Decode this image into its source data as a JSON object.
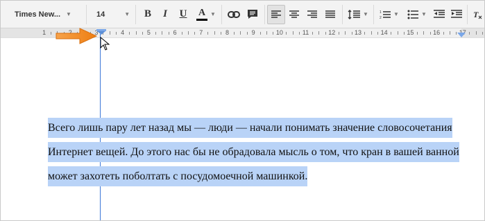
{
  "toolbar": {
    "font_family": "Times New...",
    "font_size": "14",
    "bold_label": "B",
    "italic_label": "I",
    "underline_label": "U",
    "text_color_label": "A"
  },
  "icons": {
    "link": "link-icon",
    "comment": "comment-icon",
    "align_left": "align-left-icon",
    "align_center": "align-center-icon",
    "align_right": "align-right-icon",
    "align_justify": "align-justify-icon",
    "line_spacing": "line-spacing-icon",
    "numbered_list": "numbered-list-icon",
    "bulleted_list": "bulleted-list-icon",
    "decrease_indent": "decrease-indent-icon",
    "increase_indent": "increase-indent-icon",
    "clear_formatting": "clear-formatting-icon"
  },
  "ruler": {
    "labels": [
      "1",
      "2",
      "3",
      "4",
      "5",
      "6",
      "7",
      "8",
      "9",
      "10",
      "11",
      "12",
      "13",
      "14",
      "15",
      "16",
      "17"
    ]
  },
  "document": {
    "paragraph": "Всего лишь пару лет назад мы — люди — начали понимать значение словосочетания Интернет вещей. До этого нас бы не обрадовала мысль о том, что кран в вашей ванной может захотеть поболтать с посудомоечной машинкой."
  },
  "colors": {
    "selection": "#b9d3f7",
    "guide_line": "#3c78d8",
    "annotation_arrow": "#f08a1c"
  }
}
